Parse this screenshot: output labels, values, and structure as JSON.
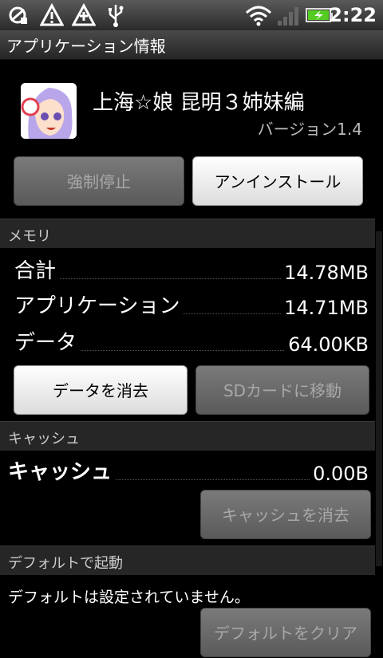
{
  "status_bar": {
    "time": "2:22",
    "icons": [
      "debug-icon",
      "warning-icon",
      "warning-icon",
      "usb-icon",
      "wifi-icon",
      "signal-icon",
      "battery-charging-icon"
    ]
  },
  "title": "アプリケーション情報",
  "app": {
    "name": "上海☆娘 昆明３姉妹編",
    "version": "バージョン1.4"
  },
  "actions": {
    "force_stop": "強制停止",
    "uninstall": "アンインストール"
  },
  "memory": {
    "header": "メモリ",
    "rows": [
      {
        "label": "合計",
        "value": "14.78MB"
      },
      {
        "label": "アプリケーション",
        "value": "14.71MB"
      },
      {
        "label": "データ",
        "value": "64.00KB"
      }
    ],
    "clear_data": "データを消去",
    "move_sd": "SDカードに移動"
  },
  "cache": {
    "header": "キャッシュ",
    "label": "キャッシュ",
    "value": "0.00B",
    "clear_cache": "キャッシュを消去"
  },
  "defaults": {
    "header": "デフォルトで起動",
    "message": "デフォルトは設定されていません。",
    "clear_defaults": "デフォルトをクリア"
  },
  "colors": {
    "background": "#000000",
    "section_header": "#262626",
    "disabled_button": "#6a6a6a",
    "enabled_button": "#f0f0f0",
    "battery": "#55cc22"
  }
}
